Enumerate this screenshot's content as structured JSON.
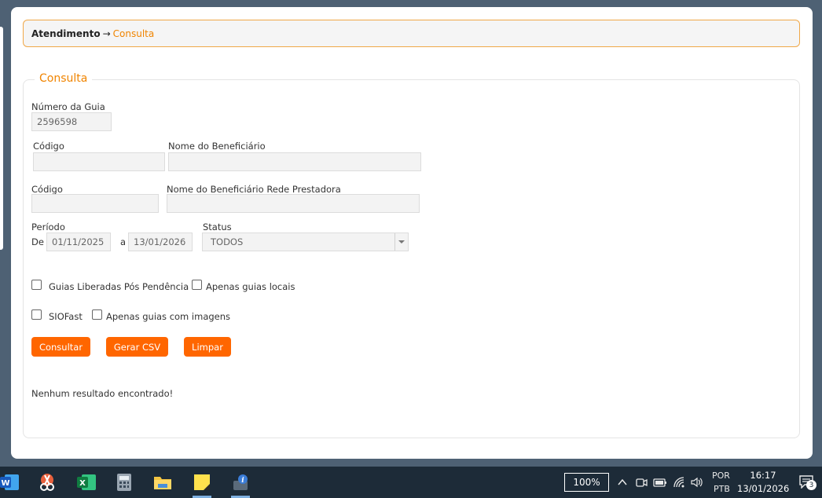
{
  "breadcrumb": {
    "root": "Atendimento",
    "arrow": "→",
    "current": "Consulta"
  },
  "form": {
    "legend": "Consulta",
    "numero_guia": {
      "label": "Número da Guia",
      "value": "2596598"
    },
    "codigo_1": {
      "label": "Código",
      "value": ""
    },
    "nome_beneficiario": {
      "label": "Nome do Beneficiário",
      "value": ""
    },
    "codigo_2": {
      "label": "Código",
      "value": ""
    },
    "nome_rede": {
      "label": "Nome do Beneficiário Rede Prestadora",
      "value": ""
    },
    "periodo": {
      "label": "Período",
      "de_label": "De",
      "de_value": "01/11/2025",
      "a_label": "a",
      "a_value": "13/01/2026"
    },
    "status": {
      "label": "Status",
      "selected": "TODOS"
    },
    "checkboxes": {
      "pos_pendencia": "Guias Liberadas Pós Pendência",
      "apenas_locais": "Apenas guias locais",
      "siofast": "SIOFast",
      "com_imagens": "Apenas guias com imagens"
    },
    "buttons": {
      "consultar": "Consultar",
      "gerar_csv": "Gerar CSV",
      "limpar": "Limpar"
    },
    "result_message": "Nenhum resultado encontrado!"
  },
  "taskbar": {
    "zoom": "100%",
    "lang_top": "POR",
    "lang_bottom": "PTB",
    "time": "16:17",
    "date": "13/01/2026",
    "notifications": "3"
  },
  "colors": {
    "accent": "#f08400",
    "button": "#ff6600",
    "taskbar": "#1d2b38",
    "background": "#4e6174"
  }
}
